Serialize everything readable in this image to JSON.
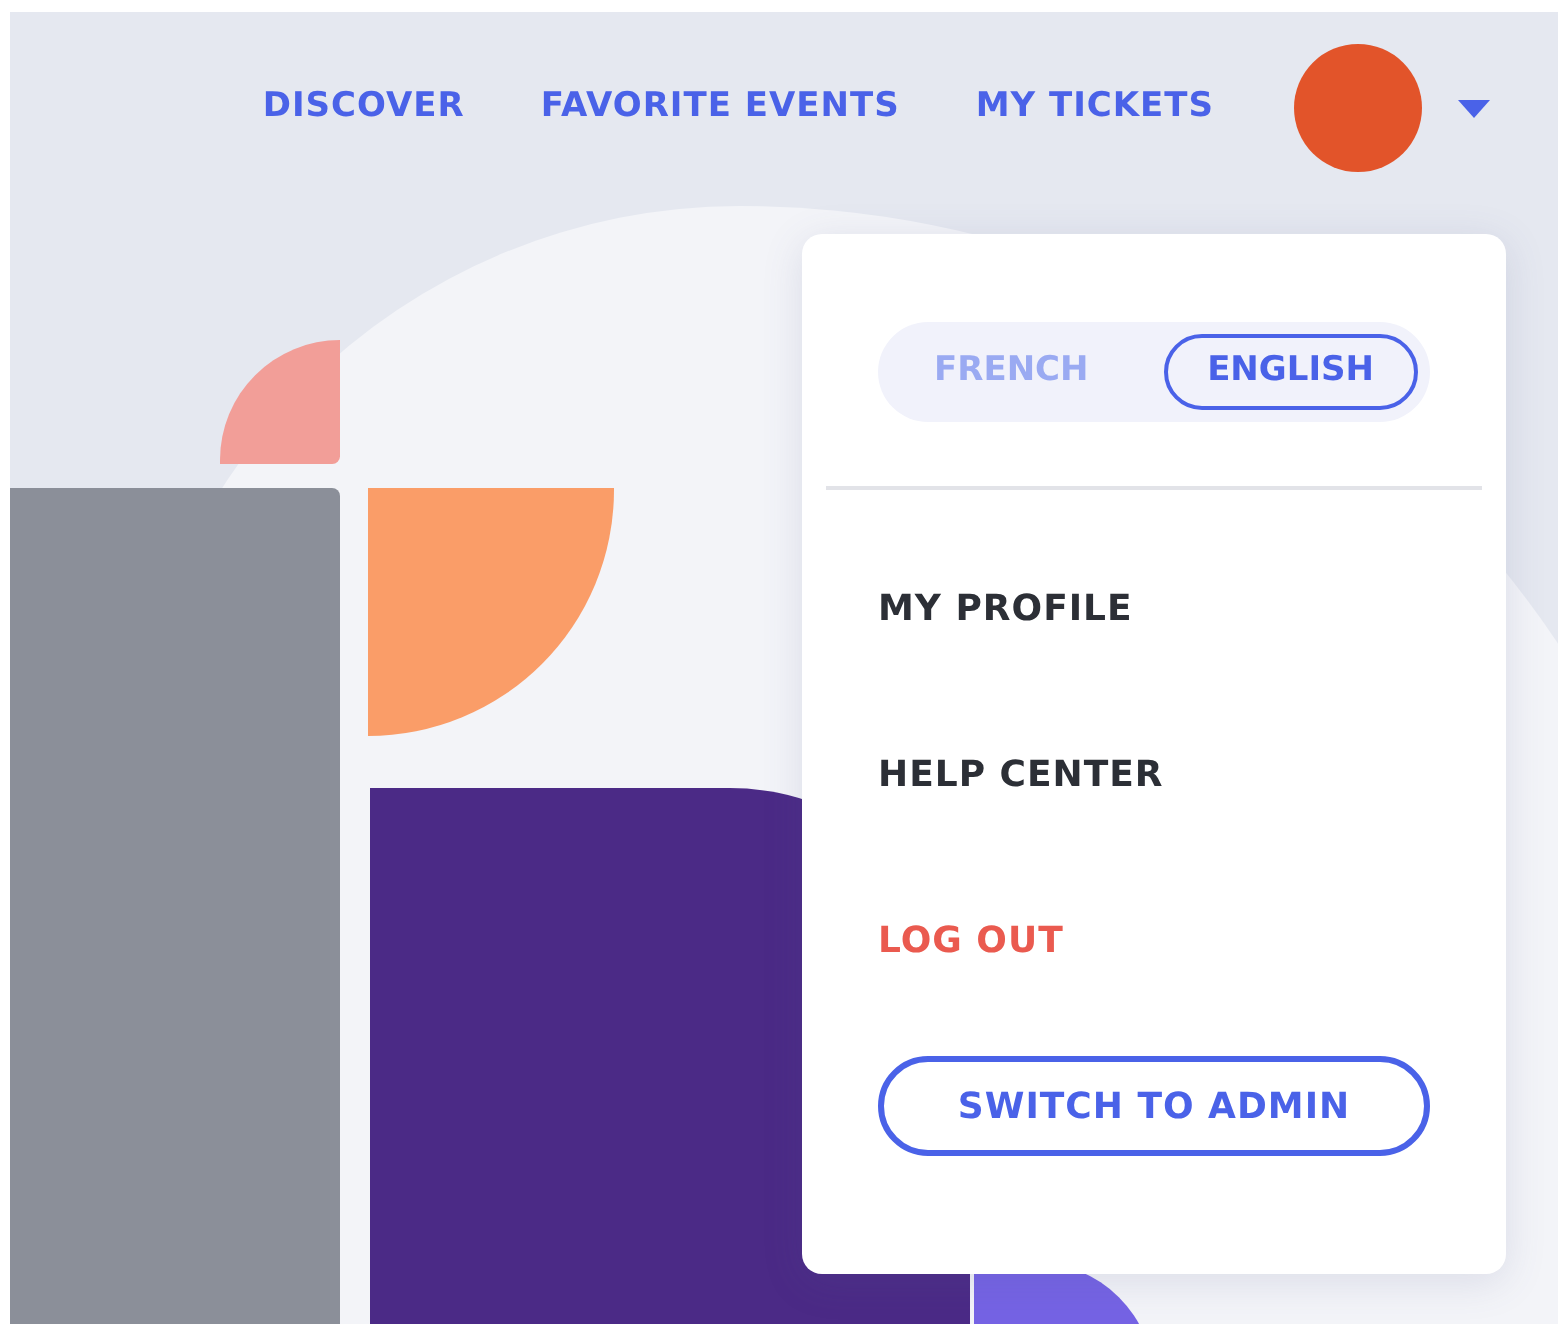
{
  "nav": {
    "links": [
      {
        "label": "DISCOVER"
      },
      {
        "label": "FAVORITE EVENTS"
      },
      {
        "label": "MY TICKETS"
      }
    ],
    "menu_open": true
  },
  "dropdown": {
    "languages": [
      {
        "label": "FRENCH",
        "selected": false
      },
      {
        "label": "ENGLISH",
        "selected": true
      }
    ],
    "items": [
      {
        "kind": "link",
        "label": "MY PROFILE"
      },
      {
        "kind": "link",
        "label": "HELP CENTER"
      },
      {
        "kind": "danger",
        "label": "LOG OUT"
      },
      {
        "kind": "button",
        "label": "SWITCH TO ADMIN"
      }
    ]
  }
}
